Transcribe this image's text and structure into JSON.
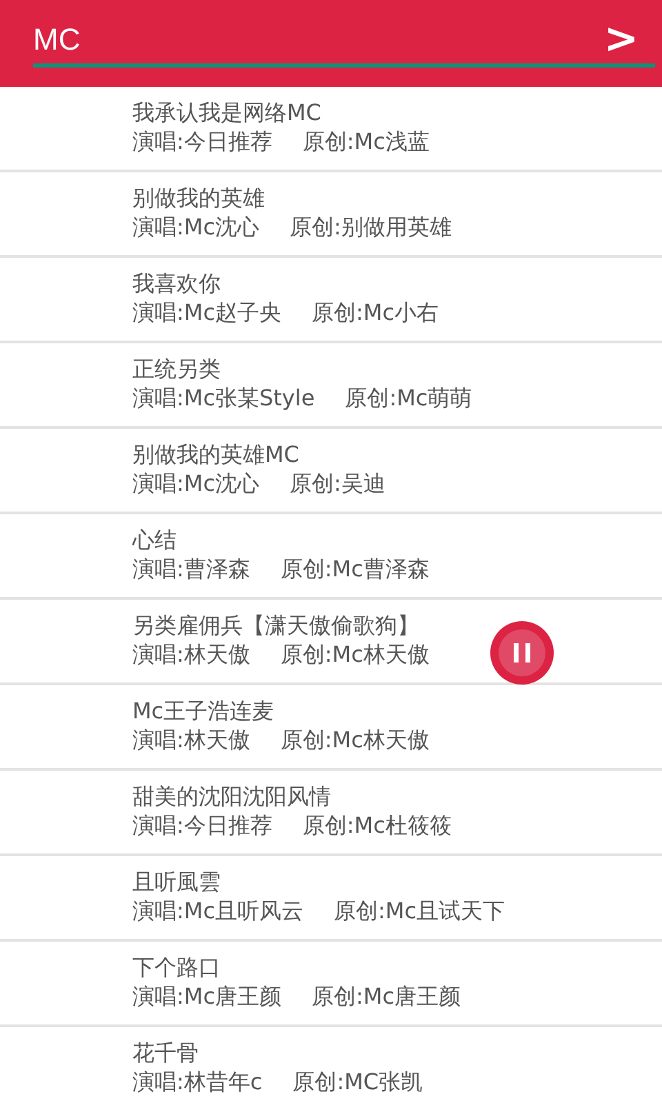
{
  "search": {
    "value": "MC",
    "submit_label": ">"
  },
  "songs": [
    {
      "title": "我承认我是网络MC",
      "singer": "演唱:今日推荐",
      "original": "原创:Mc浅蓝"
    },
    {
      "title": "别做我的英雄",
      "singer": "演唱:Mc沈心",
      "original": "原创:别做用英雄"
    },
    {
      "title": "我喜欢你",
      "singer": "演唱:Mc赵子央",
      "original": "原创:Mc小右"
    },
    {
      "title": "正统另类",
      "singer": "演唱:Mc张某Style",
      "original": "原创:Mc萌萌"
    },
    {
      "title": "别做我的英雄MC",
      "singer": "演唱:Mc沈心",
      "original": "原创:吴迪"
    },
    {
      "title": "心结",
      "singer": "演唱:曹泽森",
      "original": "原创:Mc曹泽森"
    },
    {
      "title": "另类雇佣兵【潇天傲偷歌狗】",
      "singer": "演唱:林天傲",
      "original": "原创:Mc林天傲"
    },
    {
      "title": "Mc王子浩连麦",
      "singer": "演唱:林天傲",
      "original": "原创:Mc林天傲"
    },
    {
      "title": "甜美的沈阳沈阳风情",
      "singer": "演唱:今日推荐",
      "original": "原创:Mc杜筱筱"
    },
    {
      "title": "且听風雲",
      "singer": "演唱:Mc且听风云",
      "original": "原创:Mc且试天下"
    },
    {
      "title": "下个路口",
      "singer": "演唱:Mc唐王颜",
      "original": "原创:Mc唐王颜"
    },
    {
      "title": "花千骨",
      "singer": "演唱:林昔年c",
      "original": "原创:MC张凯"
    }
  ],
  "player": {
    "playing": true
  }
}
